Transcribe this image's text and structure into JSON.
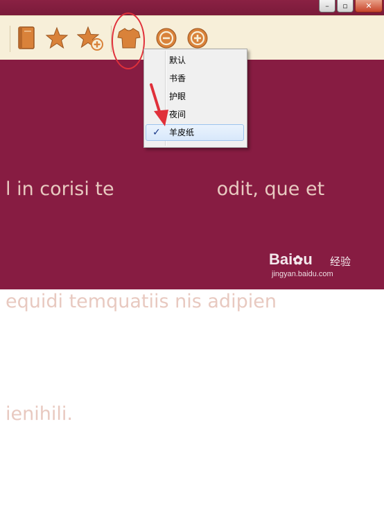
{
  "window": {
    "minimize_glyph": "–",
    "maximize_glyph": "▫",
    "close_glyph": "✕"
  },
  "colors": {
    "theme_background": "#871c42",
    "theme_text": "#e8c9c0",
    "toolbar_background": "#f7efd9",
    "icon_orange": "#d9823a",
    "annotation_red": "#e0303a"
  },
  "toolbar": {
    "icons": [
      "book-icon",
      "star-icon",
      "add-bookmark-star-icon",
      "shirt-theme-icon",
      "zoom-out-icon",
      "zoom-in-icon"
    ]
  },
  "content": {
    "lines": [
      "l in corisi te",
      "equidi temquatiis nis adipien",
      "ienihili."
    ],
    "line1_tail": "odit, que et"
  },
  "theme_menu": {
    "items": [
      {
        "label": "默认",
        "checked": false
      },
      {
        "label": "书香",
        "checked": false
      },
      {
        "label": "护眼",
        "checked": false
      },
      {
        "label": "夜间",
        "checked": false
      },
      {
        "label": "羊皮纸",
        "checked": true
      }
    ],
    "check_glyph": "✓"
  },
  "watermark": {
    "logo": "Bai",
    "logo_suffix": "经验",
    "url": "jingyan.baidu.com"
  }
}
